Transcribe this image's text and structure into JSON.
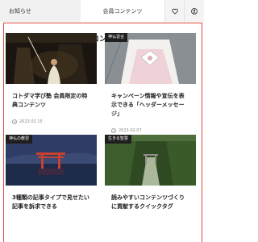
{
  "tabs": {
    "news": "お知らせ",
    "members": "会員コンテンツ",
    "favorites_icon": "heart-icon",
    "account_icon": "user-icon"
  },
  "section": {
    "title": "会員コンテンツ"
  },
  "cards": [
    {
      "badge": "",
      "title": "コトダマ学び塾 会員限定の特典コンテンツ",
      "date": "2023.02.15"
    },
    {
      "badge": "神仏習合",
      "title": "キャンペーン情報や宣伝を表示できる「ヘッダーメッセージ」",
      "date": "2023.02.07"
    },
    {
      "badge": "神仏の教習",
      "title": "3種類の記事タイプで見せたい記事を訴求できる",
      "date": ""
    },
    {
      "badge": "生きる智慧",
      "title": "読みやすいコンテンツづくりに貢献するクイックタグ",
      "date": ""
    }
  ],
  "colors": {
    "frame_border": "#e04a3a",
    "badge_bg": "#1f1f1f"
  }
}
